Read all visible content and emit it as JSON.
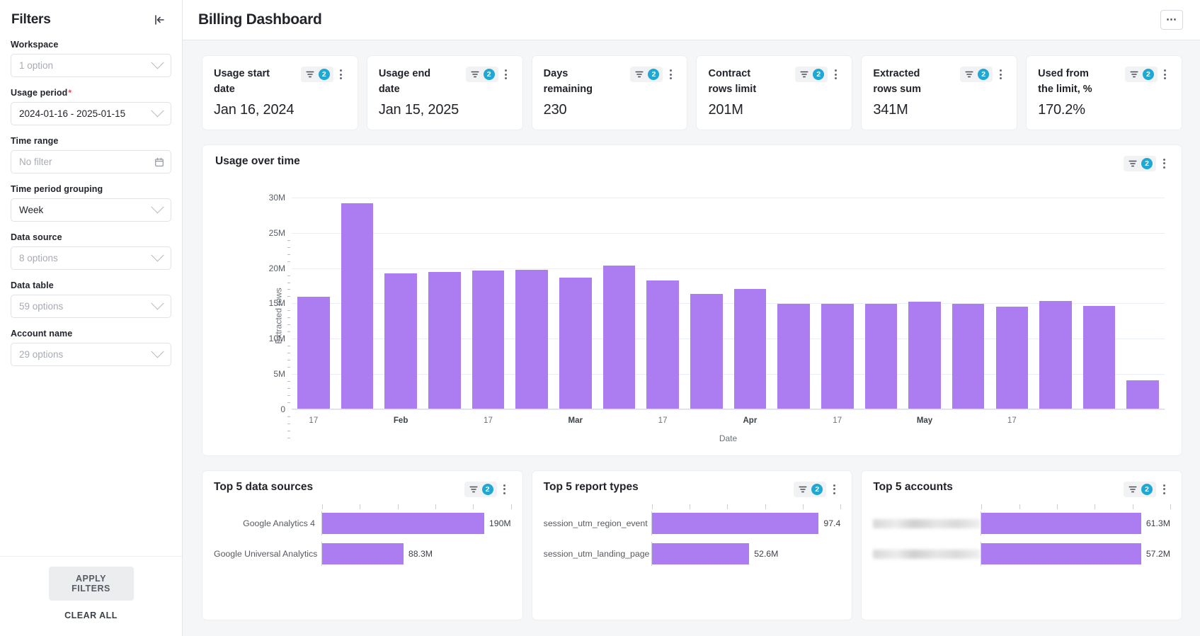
{
  "sidebar": {
    "title": "Filters",
    "collapse_icon": "collapse-left-icon",
    "fields": [
      {
        "label": "Workspace",
        "required": false,
        "value": "1 option",
        "placeholder": true,
        "control": "select"
      },
      {
        "label": "Usage period",
        "required": true,
        "value": "2024-01-16 - 2025-01-15",
        "placeholder": false,
        "control": "select"
      },
      {
        "label": "Time range",
        "required": false,
        "value": "No filter",
        "placeholder": true,
        "control": "date"
      },
      {
        "label": "Time period grouping",
        "required": false,
        "value": "Week",
        "placeholder": false,
        "control": "select"
      },
      {
        "label": "Data source",
        "required": false,
        "value": "8 options",
        "placeholder": true,
        "control": "select"
      },
      {
        "label": "Data table",
        "required": false,
        "value": "59 options",
        "placeholder": true,
        "control": "select"
      },
      {
        "label": "Account name",
        "required": false,
        "value": "29 options",
        "placeholder": true,
        "control": "select"
      }
    ],
    "apply_label": "APPLY FILTERS",
    "clear_label": "CLEAR ALL"
  },
  "header": {
    "title": "Billing Dashboard",
    "more_label": "⋯"
  },
  "colors": {
    "bar": "#ab7df0",
    "badge": "#1fa8d4",
    "required": "#e5484d"
  },
  "kpis": [
    {
      "label": "Usage start date",
      "value": "Jan 16, 2024",
      "filter_count": "2"
    },
    {
      "label": "Usage end date",
      "value": "Jan 15, 2025",
      "filter_count": "2"
    },
    {
      "label": "Days remaining",
      "value": "230",
      "filter_count": "2"
    },
    {
      "label": "Contract rows limit",
      "value": "201M",
      "filter_count": "2"
    },
    {
      "label": "Extracted rows sum",
      "value": "341M",
      "filter_count": "2"
    },
    {
      "label": "Used from the limit, %",
      "value": "170.2%",
      "filter_count": "2"
    }
  ],
  "usage_panel": {
    "title": "Usage over time",
    "filter_count": "2"
  },
  "top_panels": [
    {
      "title": "Top 5 data sources",
      "filter_count": "2"
    },
    {
      "title": "Top 5 report types",
      "filter_count": "2"
    },
    {
      "title": "Top 5 accounts",
      "filter_count": "2"
    }
  ],
  "chart_data": [
    {
      "type": "bar",
      "title": "Usage over time",
      "xlabel": "Date",
      "ylabel": "Extracted rows",
      "ylim": [
        0,
        31500000
      ],
      "yticks": [
        0,
        5000000,
        10000000,
        15000000,
        20000000,
        25000000,
        30000000
      ],
      "ytick_labels": [
        "0",
        "5M",
        "10M",
        "15M",
        "20M",
        "25M",
        "30M"
      ],
      "grid": true,
      "legend": "none",
      "categories": [
        "17",
        "",
        "Feb",
        "",
        "17",
        "",
        "Mar",
        "",
        "17",
        "",
        "Apr",
        "",
        "17",
        "",
        "May",
        "",
        "17",
        ""
      ],
      "xtick_labels": [
        "17",
        "",
        "Feb",
        "",
        "17",
        "",
        "Mar",
        "",
        "17",
        "",
        "Apr",
        "",
        "17",
        "",
        "May",
        "",
        "17",
        ""
      ],
      "values": [
        15900000,
        29200000,
        19300000,
        19500000,
        19700000,
        19800000,
        18700000,
        20400000,
        18300000,
        16300000,
        17000000,
        14900000,
        14900000,
        14900000,
        15200000,
        14900000,
        14500000,
        15300000,
        14600000,
        4100000
      ]
    },
    {
      "type": "bar",
      "orientation": "horizontal",
      "title": "Top 5 data sources",
      "categories": [
        "Google Analytics 4",
        "Google Universal Analytics"
      ],
      "values": [
        190000000,
        88300000
      ],
      "value_labels": [
        "190M",
        "88.3M"
      ],
      "xlim": [
        0,
        205000000
      ]
    },
    {
      "type": "bar",
      "orientation": "horizontal",
      "title": "Top 5 report types",
      "categories": [
        "session_utm_region_event",
        "session_utm_landing_page"
      ],
      "values": [
        97400000,
        52600000
      ],
      "value_labels": [
        "97.4",
        "52.6M"
      ],
      "xlim": [
        0,
        102000000
      ]
    },
    {
      "type": "bar",
      "orientation": "horizontal",
      "title": "Top 5 accounts",
      "categories": [
        "",
        ""
      ],
      "categories_redacted": true,
      "values": [
        61300000,
        57200000
      ],
      "value_labels": [
        "61.3M",
        "57.2M"
      ],
      "xlim": [
        0,
        66000000
      ]
    }
  ]
}
